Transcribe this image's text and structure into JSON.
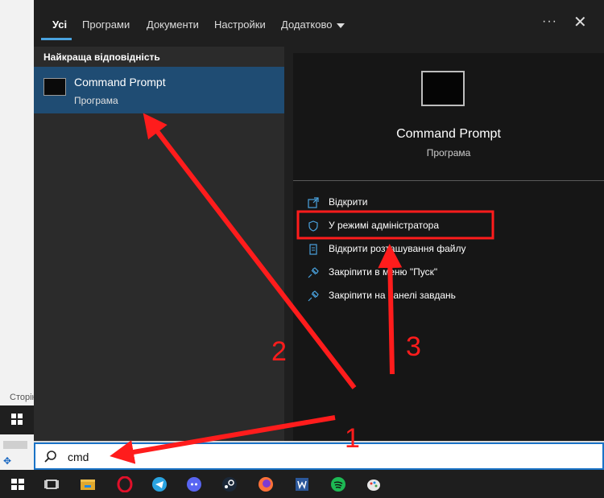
{
  "tabs": [
    "Усі",
    "Програми",
    "Документи",
    "Настройки",
    "Додатково"
  ],
  "more_label": "···",
  "close_label": "✕",
  "best_match": {
    "section_title": "Найкраща відповідність",
    "name": "Command Prompt",
    "type": "Програма"
  },
  "preview": {
    "title": "Command Prompt",
    "subtitle": "Програма"
  },
  "actions": [
    {
      "label": "Відкрити",
      "icon": "open-icon"
    },
    {
      "label": "У режимі адміністратора",
      "icon": "shield-icon"
    },
    {
      "label": "Відкрити розташування файлу",
      "icon": "file-location-icon"
    },
    {
      "label": "Закріпити в меню \"Пуск\"",
      "icon": "pin-icon"
    },
    {
      "label": "Закріпити на панелі завдань",
      "icon": "pin-icon"
    }
  ],
  "search": {
    "value": "cmd"
  },
  "background": {
    "partial_text": "Сторін"
  },
  "taskbar_icons": [
    "windows-start-icon",
    "task-view-icon",
    "file-explorer-icon",
    "opera-icon",
    "telegram-icon",
    "discord-icon",
    "steam-icon",
    "firefox-icon",
    "word-icon",
    "spotify-icon",
    "paint-icon"
  ],
  "annotations": {
    "labels": [
      "1",
      "2",
      "3"
    ],
    "color": "#ff1c1c"
  },
  "colors": {
    "accent": "#4aa3df",
    "selection": "#1f4c73",
    "annotation": "#ff1c1c"
  }
}
